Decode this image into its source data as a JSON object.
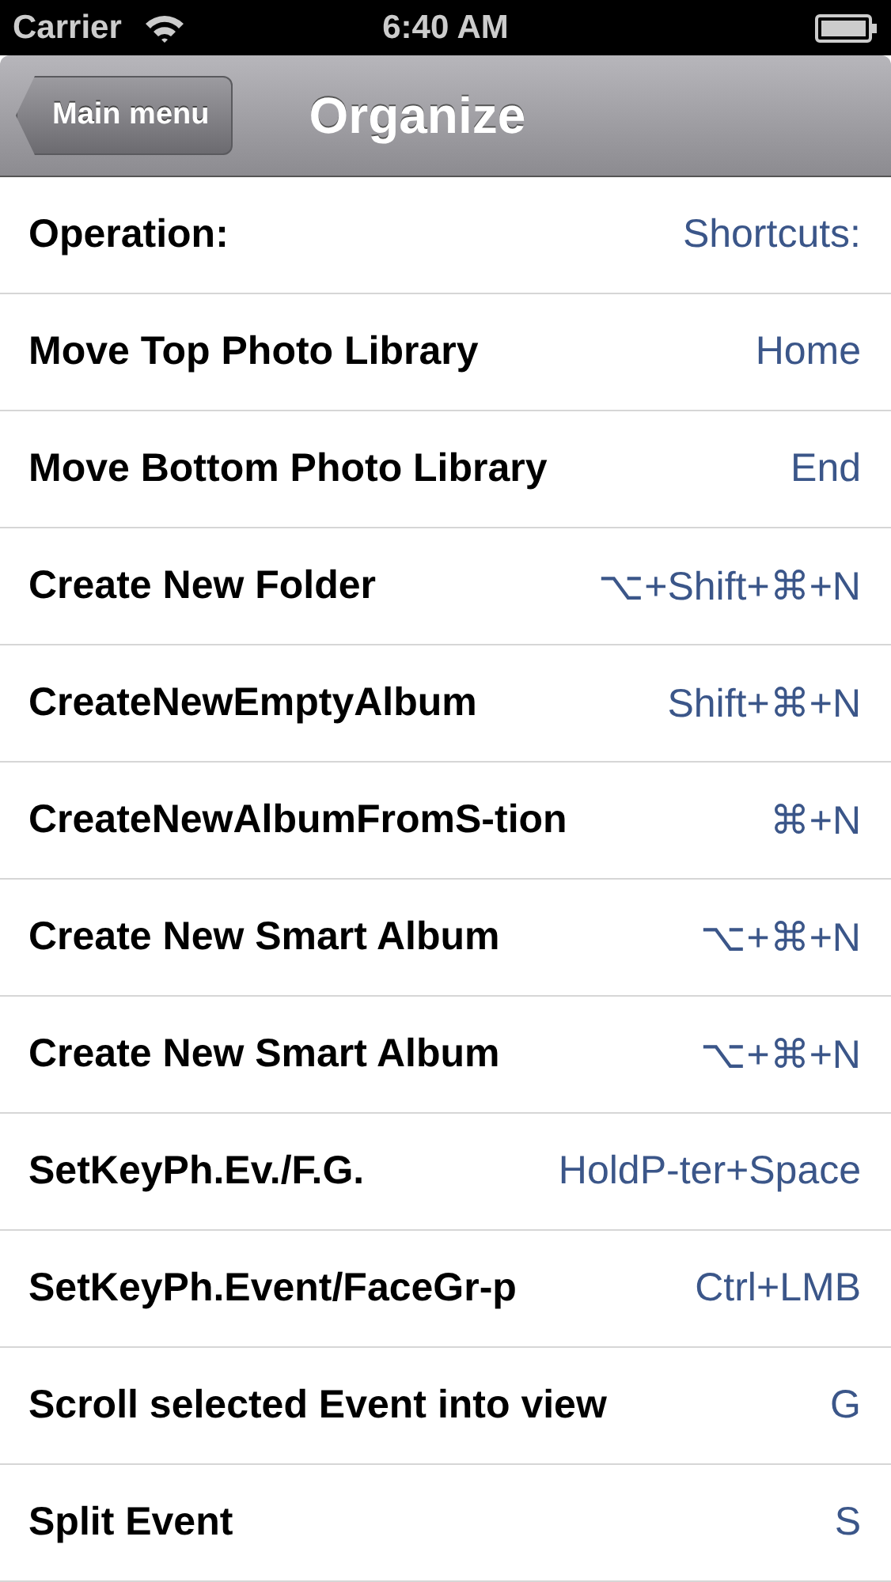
{
  "status_bar": {
    "carrier": "Carrier",
    "time": "6:40 AM"
  },
  "nav_bar": {
    "back_button": "Main menu",
    "title": "Organize"
  },
  "rows": [
    {
      "operation": "Operation:",
      "shortcut": "Shortcuts:"
    },
    {
      "operation": "Move Top Photo Library",
      "shortcut": "Home"
    },
    {
      "operation": "Move Bottom Photo Library",
      "shortcut": "End"
    },
    {
      "operation": "Create New Folder",
      "shortcut": "⌥+Shift+⌘+N"
    },
    {
      "operation": "CreateNewEmptyAlbum",
      "shortcut": "Shift+⌘+N"
    },
    {
      "operation": "CreateNewAlbumFromS-tion",
      "shortcut": "⌘+N"
    },
    {
      "operation": "Create New Smart Album",
      "shortcut": "⌥+⌘+N"
    },
    {
      "operation": "Create New Smart Album",
      "shortcut": "⌥+⌘+N"
    },
    {
      "operation": "SetKeyPh.Ev./F.G.",
      "shortcut": "HoldP-ter+Space"
    },
    {
      "operation": "SetKeyPh.Event/FaceGr-p",
      "shortcut": "Ctrl+LMB"
    },
    {
      "operation": "Scroll selected Event into view",
      "shortcut": "G"
    },
    {
      "operation": "Split Event",
      "shortcut": "S"
    }
  ]
}
